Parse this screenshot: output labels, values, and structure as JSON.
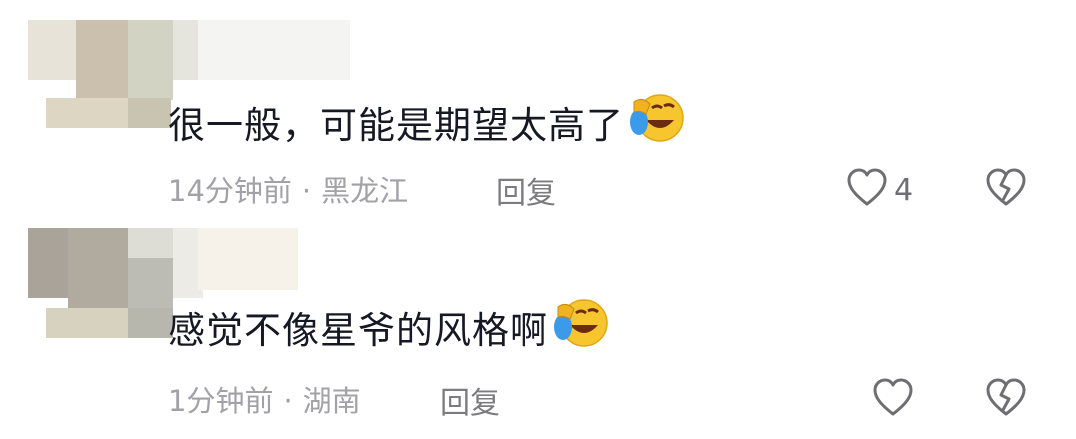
{
  "comments": [
    {
      "text": "很一般，可能是期望太高了",
      "emoji": "laughing-crying-emoji",
      "time": "14分钟前",
      "separator": "·",
      "location": "黑龙江",
      "reply_label": "回复",
      "like_count": "4"
    },
    {
      "text": "感觉不像星爷的风格啊",
      "emoji": "laughing-crying-emoji",
      "time": "1分钟前",
      "separator": "·",
      "location": "湖南",
      "reply_label": "回复",
      "like_count": ""
    }
  ],
  "colors": {
    "text": "#161823",
    "meta": "#a1a1a6",
    "icon": "#6f6f73",
    "emoji_face": "#f7c62f",
    "emoji_tear": "#3b9bea"
  }
}
